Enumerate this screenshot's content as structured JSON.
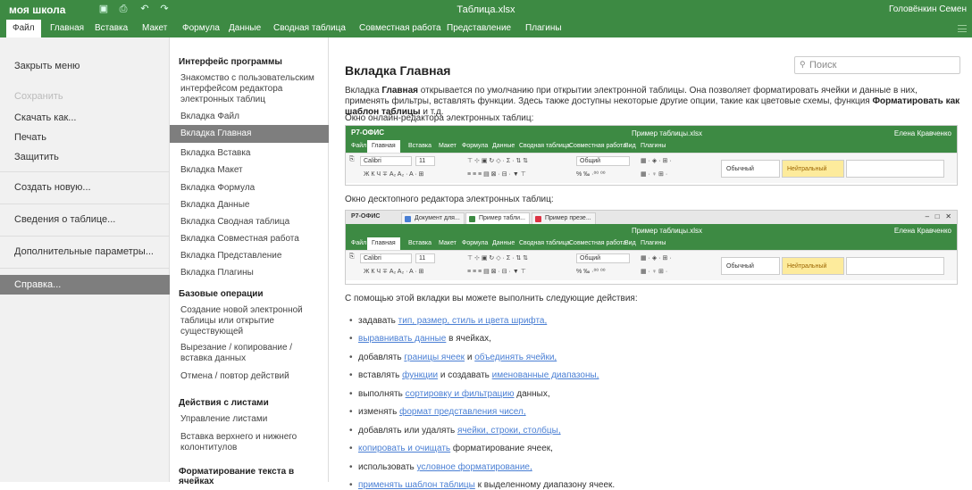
{
  "app": {
    "brand": "моя школа",
    "doc_title": "Таблица.xlsx",
    "user": "Головёнкин Семен"
  },
  "tabs": [
    {
      "label": "Файл"
    },
    {
      "label": "Главная"
    },
    {
      "label": "Вставка"
    },
    {
      "label": "Макет"
    },
    {
      "label": "Формула"
    },
    {
      "label": "Данные"
    },
    {
      "label": "Сводная таблица"
    },
    {
      "label": "Совместная работа"
    },
    {
      "label": "Представление"
    },
    {
      "label": "Плагины"
    }
  ],
  "file_menu": {
    "close": "Закрыть меню",
    "save": "Сохранить",
    "download": "Скачать как...",
    "print": "Печать",
    "protect": "Защитить",
    "create_new": "Создать новую...",
    "info": "Сведения о таблице...",
    "advanced": "Дополнительные параметры...",
    "help": "Справка..."
  },
  "help_nav": {
    "sections": [
      {
        "title": "Интерфейс программы",
        "items": [
          "Знакомство с пользовательским интерфейсом редактора электронных таблиц",
          "Вкладка Файл",
          "Вкладка Главная",
          "Вкладка Вставка",
          "Вкладка Макет",
          "Вкладка Формула",
          "Вкладка Данные",
          "Вкладка Сводная таблица",
          "Вкладка Совместная работа",
          "Вкладка Представление",
          "Вкладка Плагины"
        ]
      },
      {
        "title": "Базовые операции",
        "items": [
          "Создание новой электронной таблицы или открытие существующей",
          "Вырезание / копирование / вставка данных",
          "Отмена / повтор действий"
        ]
      },
      {
        "title": "Действия с листами",
        "items": [
          "Управление листами",
          "Вставка верхнего и нижнего колонтитулов"
        ]
      },
      {
        "title": "Форматирование текста в ячейках",
        "items": []
      }
    ]
  },
  "article": {
    "title": "Вкладка Главная",
    "search_placeholder": "Поиск",
    "intro_1": "Вкладка ",
    "intro_bold_1": "Главная",
    "intro_2": " открывается по умолчанию при открытии электронной таблицы. Она позволяет форматировать ячейки и данные в них, применять фильтры, вставлять функции. Здесь также доступны некоторые другие опции, такие как цветовые схемы, функция ",
    "intro_bold_2": "Форматировать как шаблон таблицы",
    "intro_3": " и т.д.",
    "online_caption": "Окно онлайн-редактора электронных таблиц:",
    "desktop_caption": "Окно десктопного редактора электронных таблиц:",
    "actions_lead": "С помощью этой вкладки вы можете выполнить следующие действия:",
    "bullets": [
      {
        "pre": "задавать ",
        "link": "тип, размер, стиль и цвета шрифта,",
        "post": ""
      },
      {
        "pre": "",
        "link": "выравнивать данные",
        "post": " в ячейках,"
      },
      {
        "pre": "добавлять ",
        "link": "границы ячеек",
        "mid": " и ",
        "link2": "объединять ячейки,",
        "post": ""
      },
      {
        "pre": "вставлять ",
        "link": "функции",
        "mid": " и создавать ",
        "link2": "именованные диапазоны,",
        "post": ""
      },
      {
        "pre": "выполнять ",
        "link": "сортировку и фильтрацию",
        "post": " данных,"
      },
      {
        "pre": "изменять ",
        "link": "формат представления чисел,",
        "post": ""
      },
      {
        "pre": "добавлять или удалять ",
        "link": "ячейки, строки, столбцы,",
        "post": ""
      },
      {
        "pre": "",
        "link": "копировать и очищать",
        "post": " форматирование ячеек,"
      },
      {
        "pre": "использовать ",
        "link": "условное форматирование,",
        "post": ""
      },
      {
        "pre": "",
        "link": "применять шаблон таблицы",
        "post": " к выделенному диапазону ячеек."
      }
    ]
  },
  "screenshot_online": {
    "brand": "Р7-ОФИС",
    "file": "Пример таблицы.xlsx",
    "user": "Елена Кравченко",
    "tabs": [
      "Файл",
      "Главная",
      "Вставка",
      "Макет",
      "Формула",
      "Данные",
      "Сводная таблица",
      "Совместная работа",
      "Вид",
      "Плагины"
    ],
    "font": "Calibri",
    "size": "11",
    "format": "Общий",
    "style_normal": "Обычный",
    "style_neutral": "Нейтральный"
  },
  "screenshot_desktop": {
    "brand": "Р7-ОФИС",
    "tab_doc": "Документ для...",
    "tab_table": "Пример табли...",
    "tab_pres": "Пример презе...",
    "file": "Пример таблицы.xlsx",
    "user": "Елена Кравченко",
    "tabs": [
      "Файл",
      "Главная",
      "Вставка",
      "Макет",
      "Формула",
      "Данные",
      "Сводная таблица",
      "Совместная работа",
      "Вид",
      "Плагины"
    ],
    "font": "Calibri",
    "size": "11",
    "format": "Общий",
    "style_normal": "Обычный",
    "style_neutral": "Нейтральный"
  },
  "colors": {
    "brand_green": "#3d8a43",
    "selected_gray": "#7e7e7e",
    "link": "#4a7fd4",
    "neutral_fill": "#fdeb9c"
  }
}
